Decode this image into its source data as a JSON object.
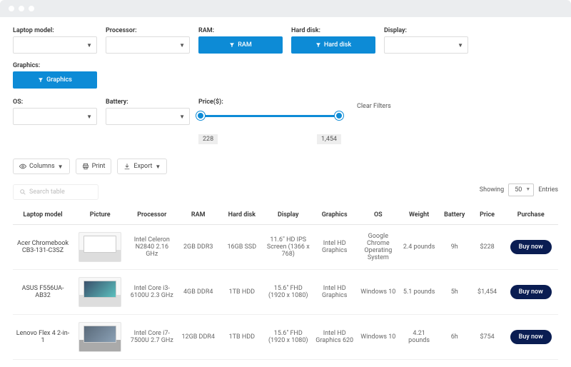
{
  "filters": {
    "row1": [
      {
        "label": "Laptop model:",
        "type": "select"
      },
      {
        "label": "Processor:",
        "type": "select"
      },
      {
        "label": "RAM:",
        "type": "button",
        "btn": "RAM"
      },
      {
        "label": "Hard disk:",
        "type": "button",
        "btn": "Hard disk"
      },
      {
        "label": "Display:",
        "type": "select"
      },
      {
        "label": "Graphics:",
        "type": "button",
        "btn": "Graphics"
      }
    ],
    "row2": [
      {
        "label": "OS:",
        "type": "select"
      },
      {
        "label": "Battery:",
        "type": "select"
      }
    ],
    "price_label": "Price($):",
    "price_min": "228",
    "price_max": "1,454",
    "clear": "Clear Filters"
  },
  "toolbar": {
    "columns": "Columns",
    "print": "Print",
    "export": "Export",
    "search_placeholder": "Search table",
    "showing": "Showing",
    "page_size": "50",
    "entries": "Entries"
  },
  "table": {
    "headers": [
      "Laptop model",
      "Picture",
      "Processor",
      "RAM",
      "Hard disk",
      "Display",
      "Graphics",
      "OS",
      "Weight",
      "Battery",
      "Price",
      "Purchase"
    ],
    "rows": [
      {
        "model": "Acer Chromebook CB3-131-C3SZ",
        "processor": "Intel Celeron N2840 2.16 GHz",
        "ram": "2GB DDR3",
        "hdd": "16GB SSD",
        "display": "11.6\" HD IPS Screen (1366 x 768)",
        "graphics": "Intel HD Graphics",
        "os": "Google Chrome Operating System",
        "weight": "2.4 pounds",
        "battery": "9h",
        "price": "$228",
        "buy": "Buy now",
        "pic": "light"
      },
      {
        "model": "ASUS F556UA-AB32",
        "processor": "Intel Core i3-6100U 2.3 GHz",
        "ram": "4GB DDR4",
        "hdd": "1TB HDD",
        "display": "15.6\" FHD (1920 x 1080)",
        "graphics": "Intel HD Graphics",
        "os": "Windows 10",
        "weight": "5.1 pounds",
        "battery": "5h",
        "price": "$1,454",
        "buy": "Buy now",
        "pic": "dark"
      },
      {
        "model": "Lenovo Flex 4 2-in-1",
        "processor": "Intel Core i7-7500U 2.7 GHz",
        "ram": "12GB DDR4",
        "hdd": "1TB HDD",
        "display": "15.6\" FHD (1920 x 1080)",
        "graphics": "Intel HD Graphics 620",
        "os": "Windows 10",
        "weight": "4.21 pounds",
        "battery": "6h",
        "price": "$754",
        "buy": "Buy now",
        "pic": "darker"
      }
    ]
  },
  "colors": {
    "primary": "#0d8bd6",
    "buy": "#0a1d52"
  }
}
